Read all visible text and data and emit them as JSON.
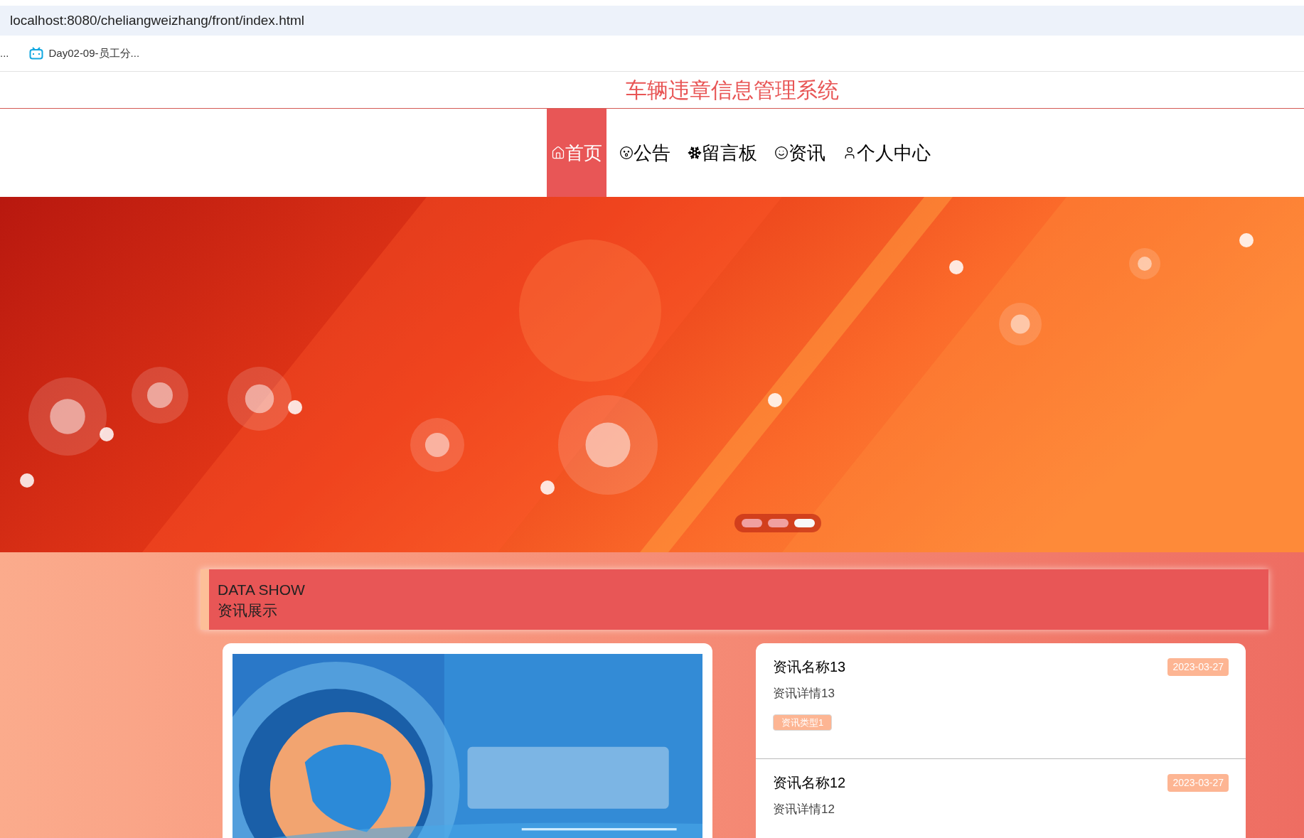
{
  "browser": {
    "url": "localhost:8080/cheliangweizhang/front/index.html",
    "bookmarks": [
      {
        "label": "...",
        "kind": "plain"
      },
      {
        "label": "Day02-09-员工分...",
        "kind": "tv"
      }
    ]
  },
  "site_title": "车辆违章信息管理系统",
  "nav": [
    {
      "label": "首页",
      "kind": "home",
      "selected": true
    },
    {
      "label": "公告",
      "kind": "notice",
      "selected": false
    },
    {
      "label": "留言板",
      "kind": "board",
      "selected": false
    },
    {
      "label": "资讯",
      "kind": "news",
      "selected": false
    },
    {
      "label": "个人中心",
      "kind": "profile",
      "selected": false
    }
  ],
  "carousel": {
    "indicators": [
      {
        "selected": false
      },
      {
        "selected": false
      },
      {
        "selected": true
      }
    ]
  },
  "section": {
    "title_en": "DATA SHOW",
    "title_zh": "资讯展示"
  },
  "news": [
    {
      "title": "资讯名称13",
      "detail": "资讯详情13",
      "date": "2023-03-27",
      "tag": "资讯类型1"
    },
    {
      "title": "资讯名称12",
      "detail": "资讯详情12",
      "date": "2023-03-27"
    }
  ]
}
